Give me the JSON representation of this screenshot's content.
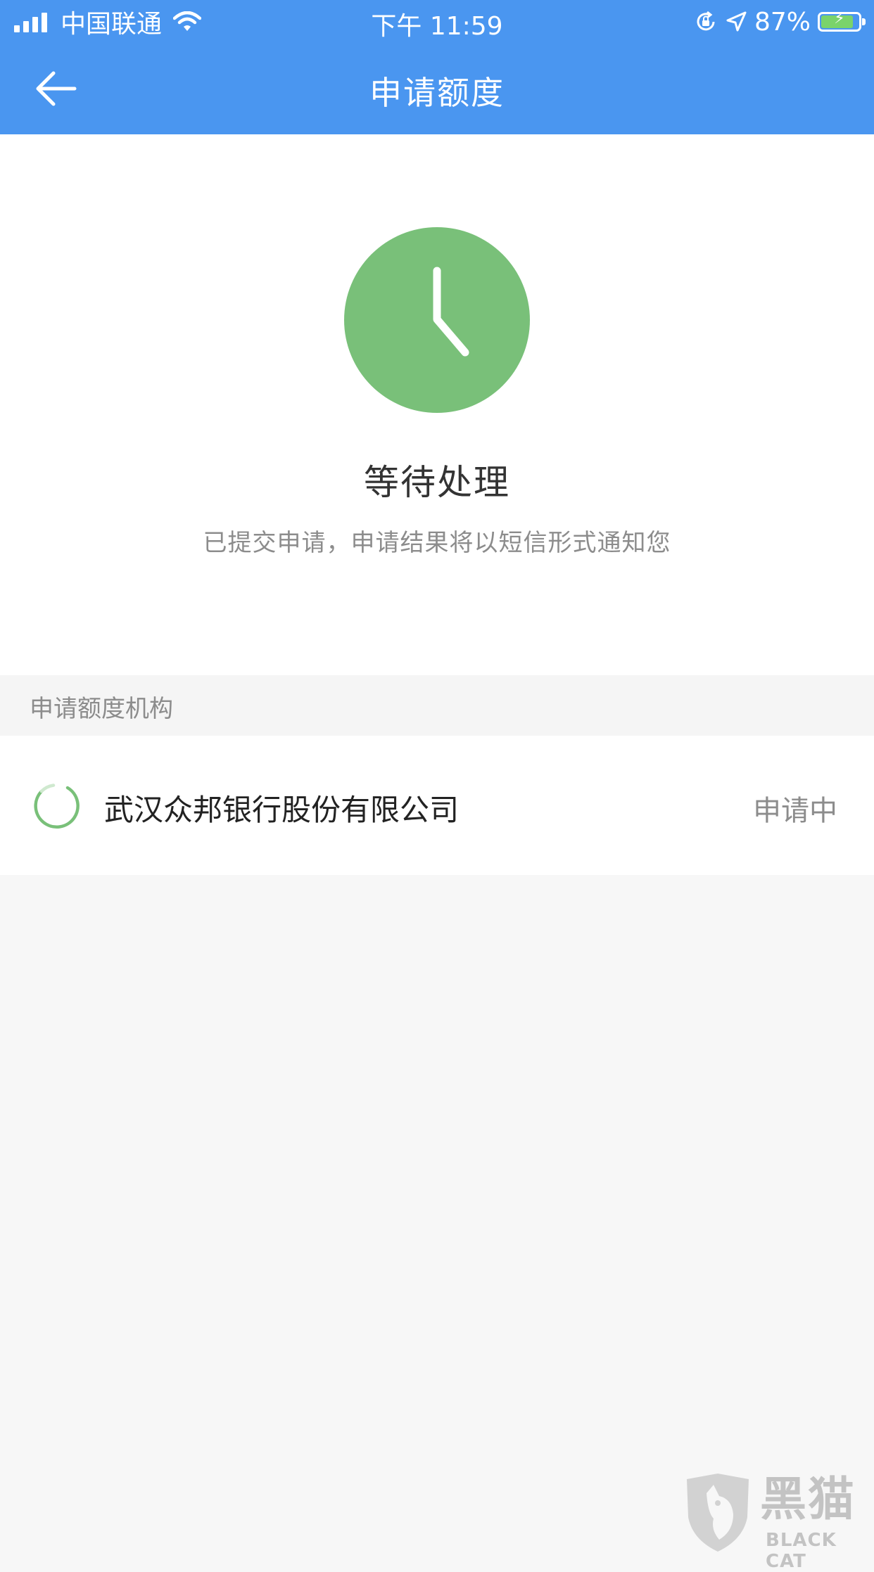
{
  "status_bar": {
    "carrier": "中国联通",
    "time": "下午 11:59",
    "battery_percent_label": "87%",
    "battery_level": 0.87,
    "icons": [
      "signal-icon",
      "wifi-icon",
      "orientation-lock-icon",
      "location-icon",
      "battery-icon"
    ]
  },
  "nav": {
    "back_icon": "arrow-left-icon",
    "title": "申请额度"
  },
  "status": {
    "icon": "clock-icon",
    "title": "等待处理",
    "description": "已提交申请，申请结果将以短信形式通知您"
  },
  "institutions": {
    "header": "申请额度机构",
    "items": [
      {
        "icon": "loading-spinner-icon",
        "name": "武汉众邦银行股份有限公司",
        "status": "申请中"
      }
    ]
  },
  "watermark": {
    "text_cn": "黑猫",
    "text_en": "BLACK CAT"
  },
  "colors": {
    "nav_blue": "#4a96f0",
    "status_green": "#79c079",
    "page_bg": "#f7f7f7"
  }
}
